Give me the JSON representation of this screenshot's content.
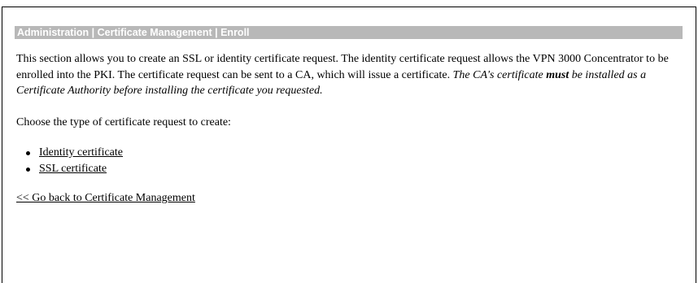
{
  "header": {
    "breadcrumb": "Administration | Certificate Management | Enroll"
  },
  "intro": {
    "text_normal": "This section allows you to create an SSL or identity certificate request. The identity certificate request allows the VPN 3000 Concentrator to be enrolled into the PKI. The certificate request can be sent to a CA, which will issue a certificate. ",
    "italic_part1": "The CA's certificate ",
    "italic_bold": "must",
    "italic_part2": " be installed as a Certificate Authority before installing the certificate you requested."
  },
  "choose_prompt": "Choose the type of certificate request to create:",
  "options": [
    {
      "label": "Identity certificate"
    },
    {
      "label": "SSL certificate"
    }
  ],
  "back_link": "<< Go back to Certificate Management"
}
